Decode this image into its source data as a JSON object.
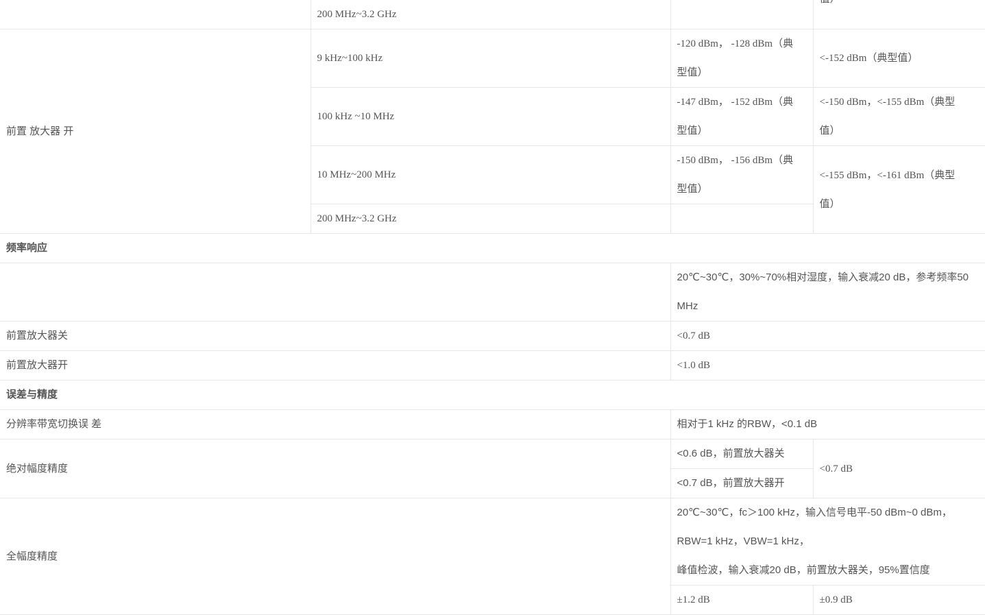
{
  "top_block": {
    "freq_range": "200 MHz~3.2 GHz",
    "partial_value": "值）"
  },
  "preamp_on": {
    "label": "前置 放大器 开",
    "rows": [
      {
        "range": "9 kHz~100 kHz",
        "spec_line1": "-120 dBm， -128 dBm（典",
        "spec_line2": "型值）",
        "typ": "<-152 dBm（典型值）"
      },
      {
        "range": "100 kHz ~10 MHz",
        "spec_line1": "-147 dBm， -152 dBm（典",
        "spec_line2": "型值）",
        "typ_line1": "<-150 dBm，<-155 dBm（典型",
        "typ_line2": "值）"
      },
      {
        "range": "10 MHz~200 MHz",
        "spec_line1": "-150 dBm， -156 dBm（典",
        "spec_line2": "型值）",
        "typ_line1": "<-155 dBm，<-161 dBm（典型",
        "typ_line2": "值）"
      },
      {
        "range": "200 MHz~3.2 GHz"
      }
    ]
  },
  "freq_response": {
    "section_title": "频率响应",
    "condition_line1": "20℃~30℃，30%~70%相对湿度，输入衰减20 dB，参考频率50",
    "condition_line2": "MHz",
    "rows": [
      {
        "label": "前置放大器关",
        "value": "<0.7 dB"
      },
      {
        "label": "前置放大器开",
        "value": "<1.0 dB"
      }
    ]
  },
  "error_accuracy": {
    "section_title": "误差与精度",
    "rbw_switch": {
      "label": "分辨率带宽切换误 差",
      "value": "相对于1 kHz 的RBW，<0.1 dB"
    },
    "absolute": {
      "label": "绝对幅度精度",
      "value_off": "<0.6 dB，前置放大器关",
      "value_on": "<0.7 dB，前置放大器开",
      "typ": "<0.7 dB"
    },
    "full_amplitude": {
      "label": "全幅度精度",
      "condition_line1": "20℃~30℃，fc＞100 kHz，输入信号电平-50 dBm~0 dBm，",
      "condition_line2": "RBW=1 kHz，VBW=1 kHz，",
      "condition_line3": "峰值检波，输入衰减20 dB，前置放大器关，95%置信度",
      "value": "±1.2 dB",
      "typ": "±0.9 dB"
    }
  }
}
